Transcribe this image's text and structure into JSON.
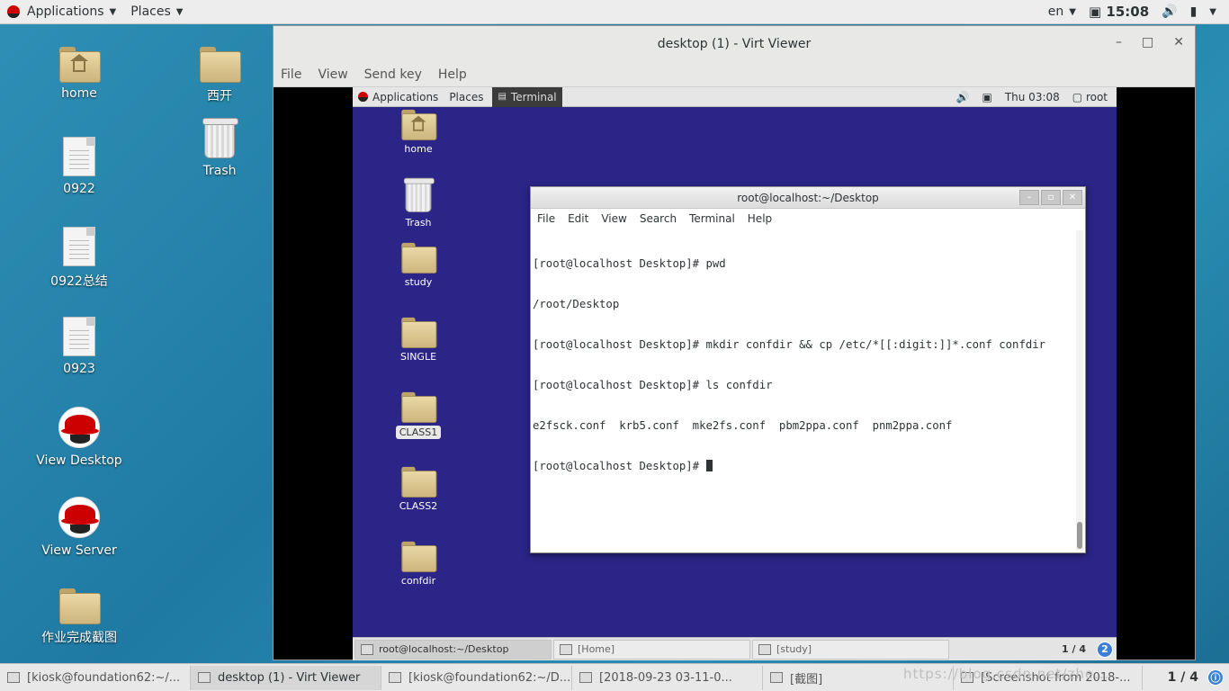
{
  "host_topbar": {
    "applications": "Applications",
    "places": "Places",
    "lang": "en",
    "clock": "15:08",
    "clock_icon": "□"
  },
  "host_desktop": {
    "icons": [
      {
        "label": "home"
      },
      {
        "label": "西开"
      },
      {
        "label": "0922"
      },
      {
        "label": "Trash"
      },
      {
        "label": "0922总结"
      },
      {
        "label": "0923"
      },
      {
        "label": "View Desktop"
      },
      {
        "label": "View Server"
      },
      {
        "label": "作业完成截图"
      }
    ]
  },
  "virt_viewer": {
    "title": "desktop (1) - Virt Viewer",
    "menu": [
      "File",
      "View",
      "Send key",
      "Help"
    ]
  },
  "guest_topbar": {
    "applications": "Applications",
    "places": "Places",
    "terminal": "Terminal",
    "clock": "Thu 03:08",
    "user": "root"
  },
  "guest_desktop": {
    "icons": [
      {
        "label": "home"
      },
      {
        "label": "Trash"
      },
      {
        "label": "study"
      },
      {
        "label": "SINGLE"
      },
      {
        "label": "CLASS1"
      },
      {
        "label": "CLASS2"
      },
      {
        "label": "confdir"
      }
    ]
  },
  "terminal": {
    "title": "root@localhost:~/Desktop",
    "menu": [
      "File",
      "Edit",
      "View",
      "Search",
      "Terminal",
      "Help"
    ],
    "lines": [
      "[root@localhost Desktop]# pwd",
      "/root/Desktop",
      "[root@localhost Desktop]# mkdir confdir && cp /etc/*[[:digit:]]*.conf confdir",
      "[root@localhost Desktop]# ls confdir",
      "e2fsck.conf  krb5.conf  mke2fs.conf  pbm2ppa.conf  pnm2ppa.conf"
    ],
    "prompt": "[root@localhost Desktop]# "
  },
  "guest_taskbar": {
    "items": [
      "root@localhost:~/Desktop",
      "[Home]",
      "[study]"
    ],
    "pager": "1 / 4",
    "badge": "2"
  },
  "host_taskbar": {
    "items": [
      "[kiosk@foundation62:~/...",
      "desktop (1) - Virt Viewer",
      "[kiosk@foundation62:~/D...",
      "[2018-09-23 03-11-0...",
      "[截图]",
      "[Screenshot from 2018-..."
    ],
    "pager": "1 / 4",
    "watermark": "https://blog.csdn.net/zhe..."
  }
}
